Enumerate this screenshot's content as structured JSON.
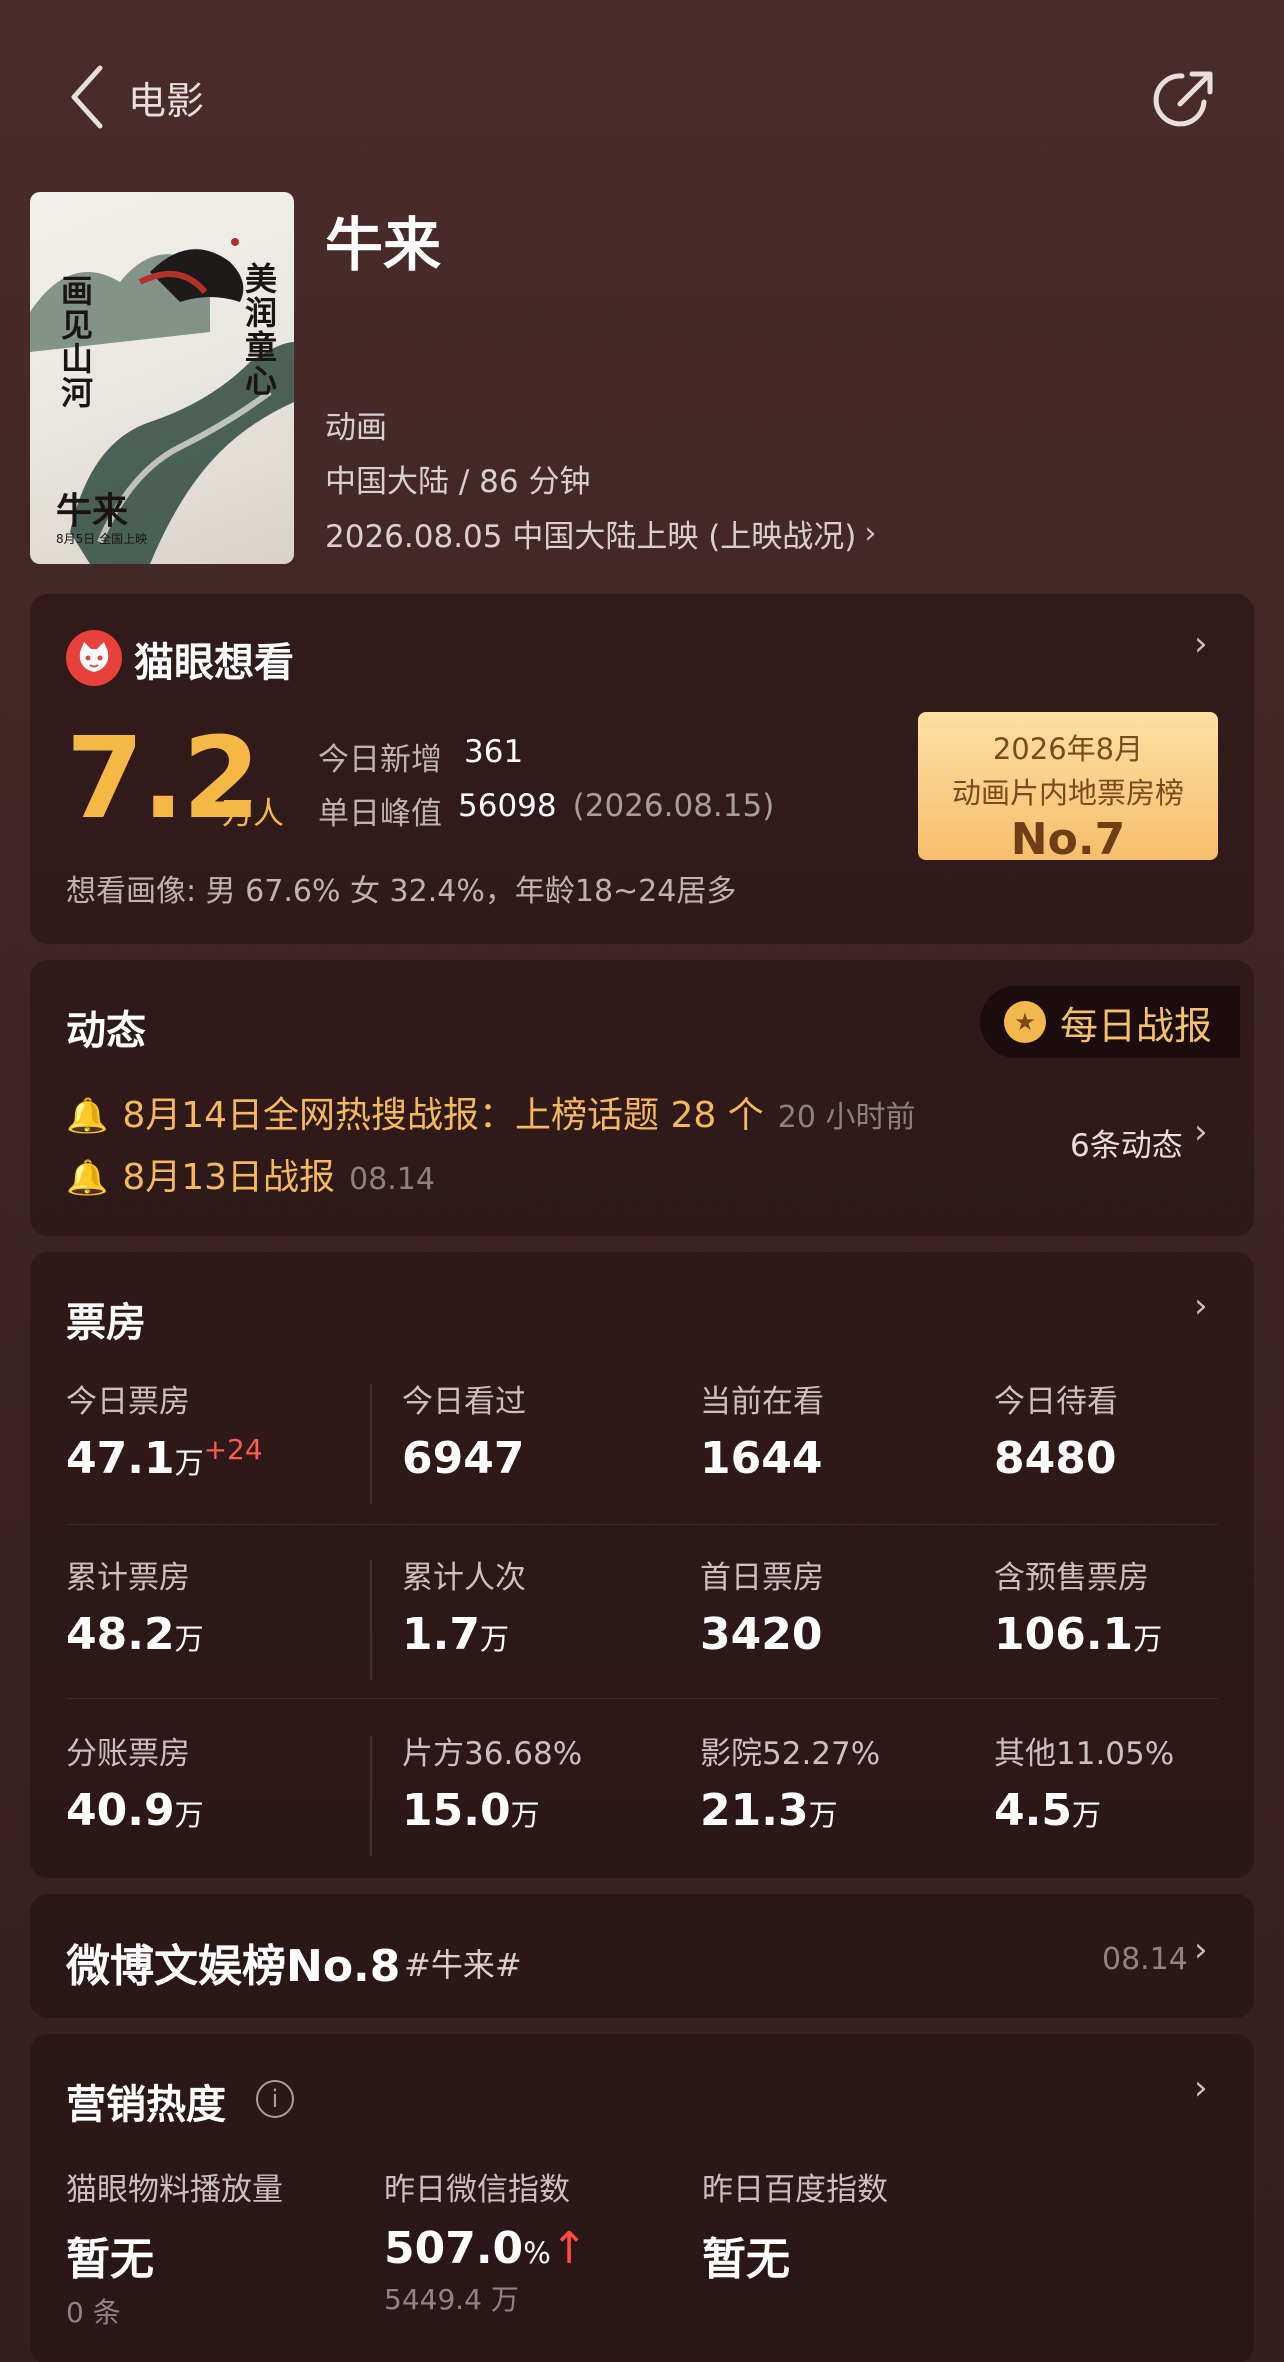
{
  "header": {
    "back_label": "电影"
  },
  "movie": {
    "title": "牛来",
    "genre": "动画",
    "region_duration": "中国大陆 / 86 分钟",
    "release": "2026.08.05 中国大陆上映 (上映战况)",
    "poster_text": {
      "left": "画见山河",
      "right": "美润童心",
      "title": "牛来",
      "date": "8月5日 全国上映"
    }
  },
  "want": {
    "title": "猫眼想看",
    "number": "7.2",
    "unit": "万人",
    "today_label": "今日新增",
    "today_value": "361",
    "peak_label": "单日峰值",
    "peak_value": "56098",
    "peak_date": "(2026.08.15)",
    "portrait": "想看画像: 男 67.6%  女 32.4%，年龄18~24居多",
    "rank_line1": "2026年8月",
    "rank_line2": "动画片内地票房榜",
    "rank_no": "No.7"
  },
  "updates": {
    "title": "动态",
    "daily_button": "每日战报",
    "items": [
      {
        "text": "8月14日全网热搜战报：上榜话题 28 个",
        "time": "20 小时前"
      },
      {
        "text": "8月13日战报",
        "time": "08.14"
      }
    ],
    "count_label": "6条动态"
  },
  "box_office": {
    "title": "票房",
    "rows": [
      [
        {
          "label": "今日票房",
          "value": "47.1",
          "unit": "万",
          "delta": "+24"
        },
        {
          "label": "今日看过",
          "value": "6947",
          "unit": ""
        },
        {
          "label": "当前在看",
          "value": "1644",
          "unit": ""
        },
        {
          "label": "今日待看",
          "value": "8480",
          "unit": ""
        }
      ],
      [
        {
          "label": "累计票房",
          "value": "48.2",
          "unit": "万"
        },
        {
          "label": "累计人次",
          "value": "1.7",
          "unit": "万"
        },
        {
          "label": "首日票房",
          "value": "3420",
          "unit": ""
        },
        {
          "label": "含预售票房",
          "value": "106.1",
          "unit": "万"
        }
      ],
      [
        {
          "label": "分账票房",
          "value": "40.9",
          "unit": "万"
        },
        {
          "label": "片方36.68%",
          "value": "15.0",
          "unit": "万"
        },
        {
          "label": "影院52.27%",
          "value": "21.3",
          "unit": "万"
        },
        {
          "label": "其他11.05%",
          "value": "4.5",
          "unit": "万"
        }
      ]
    ]
  },
  "weibo": {
    "title": "微博文娱榜No.8",
    "tag": "#牛来#",
    "date": "08.14"
  },
  "marketing": {
    "title": "营销热度",
    "items": [
      {
        "label": "猫眼物料播放量",
        "value": "暂无",
        "unit": "",
        "sub": "0 条"
      },
      {
        "label": "昨日微信指数",
        "value": "507.0",
        "unit": "%",
        "arrow": "↑",
        "sub": "5449.4 万"
      },
      {
        "label": "昨日百度指数",
        "value": "暂无",
        "unit": "",
        "sub": ""
      }
    ]
  },
  "colors": {
    "accent_gold": "#f6b844",
    "badge_bg": "#f6be6c",
    "increase_red": "#ff5c50",
    "background": "#3f2525"
  }
}
